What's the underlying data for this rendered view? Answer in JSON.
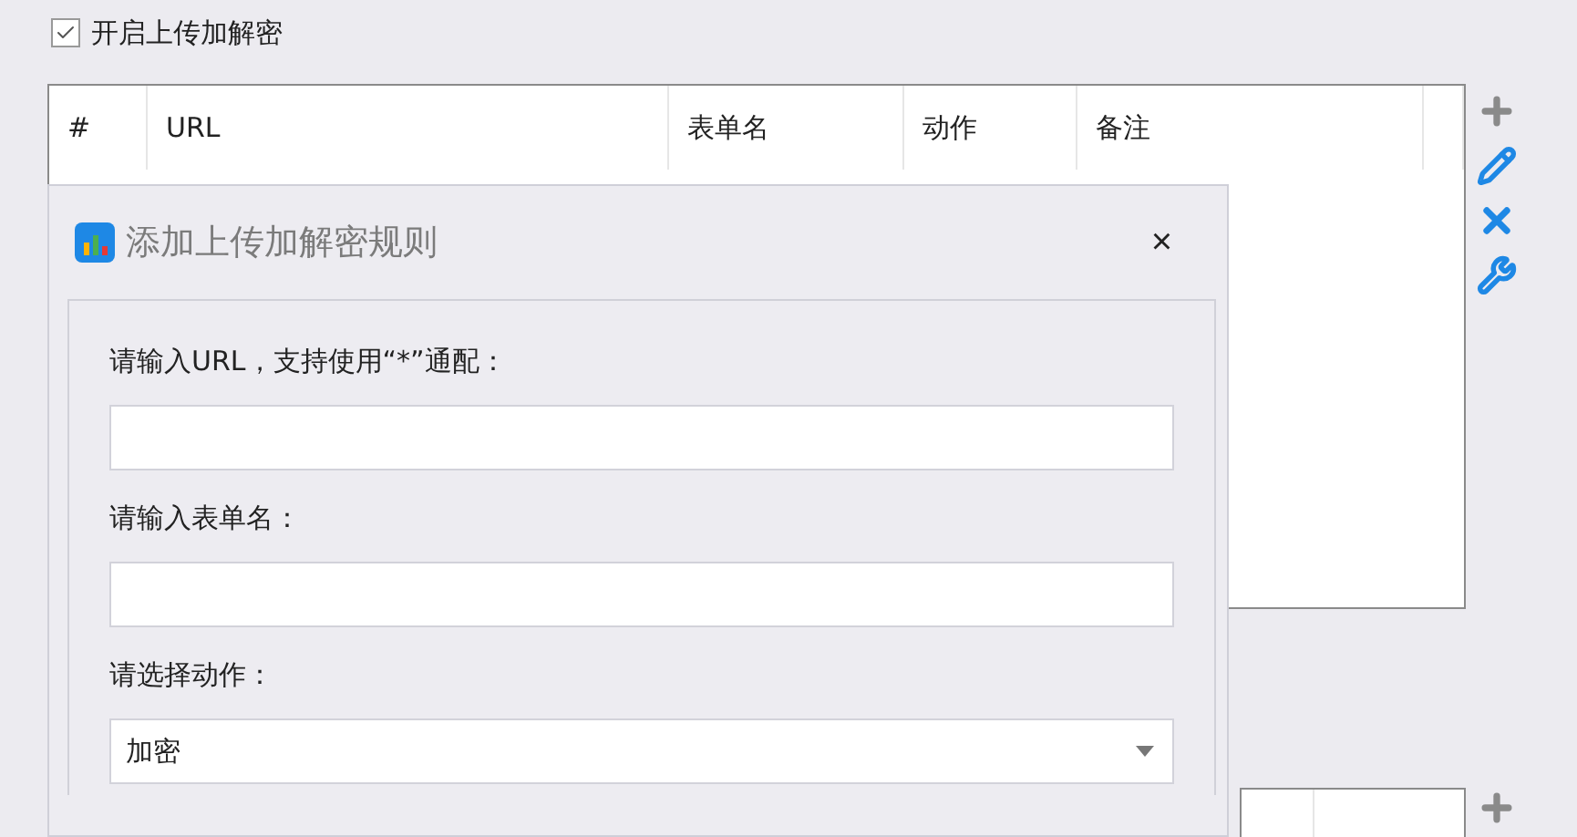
{
  "enable_checkbox": {
    "label": "开启上传加解密",
    "checked": true
  },
  "table": {
    "columns": [
      "#",
      "URL",
      "表单名",
      "动作",
      "备注"
    ]
  },
  "dialog": {
    "title": "添加上传加解密规则",
    "close": "×",
    "fields": [
      {
        "kind": "text",
        "label": "请输入URL，支持使用“*”通配："
      },
      {
        "kind": "text",
        "label": "请输入表单名："
      },
      {
        "kind": "select",
        "label": "请选择动作：",
        "value": "加密"
      }
    ]
  }
}
